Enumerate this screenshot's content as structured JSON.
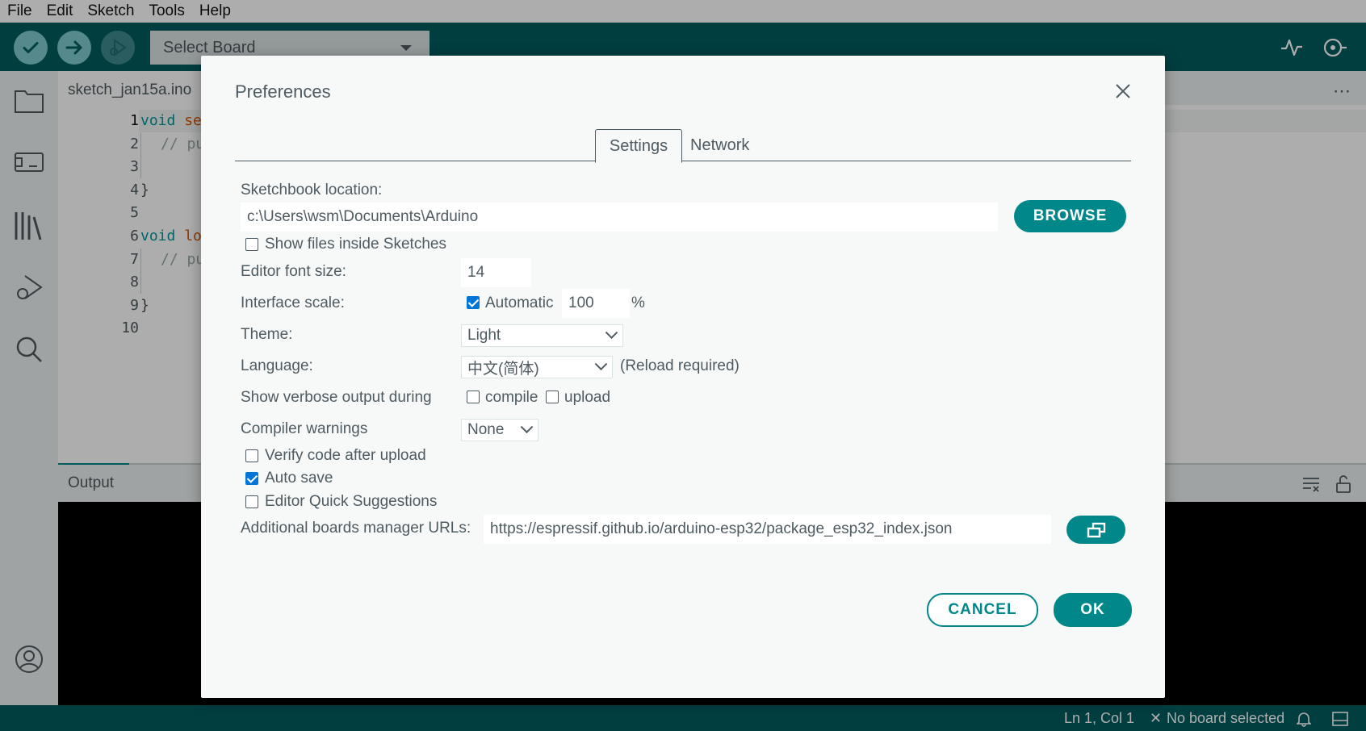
{
  "menu": [
    "File",
    "Edit",
    "Sketch",
    "Tools",
    "Help"
  ],
  "toolbar": {
    "board_select": "Select Board"
  },
  "editor": {
    "file_tab": "sketch_jan15a.ino",
    "line_numbers": [
      "1",
      "2",
      "3",
      "4",
      "5",
      "6",
      "7",
      "8",
      "9",
      "10"
    ],
    "code": {
      "l1_kw": "void",
      "l1_fn": "se",
      "l2": "// pu",
      "l4": "}",
      "l6_kw": "void",
      "l6_fn": "lo",
      "l7": "// pu",
      "l9": "}"
    }
  },
  "output": {
    "label": "Output"
  },
  "status": {
    "position": "Ln 1, Col 1",
    "board": "No board selected"
  },
  "dialog": {
    "title": "Preferences",
    "tabs": {
      "settings": "Settings",
      "network": "Network"
    },
    "sketchbook_label": "Sketchbook location:",
    "sketchbook_value": "c:\\Users\\wsm\\Documents\\Arduino",
    "browse_label": "BROWSE",
    "show_files_label": "Show files inside Sketches",
    "show_files_checked": false,
    "font_size_label": "Editor font size:",
    "font_size_value": "14",
    "scale_label": "Interface scale:",
    "scale_auto_label": "Automatic",
    "scale_auto_checked": true,
    "scale_value": "100",
    "scale_unit": "%",
    "theme_label": "Theme:",
    "theme_value": "Light",
    "language_label": "Language:",
    "language_value": "中文(简体)",
    "language_note": "(Reload required)",
    "verbose_label": "Show verbose output during",
    "verbose_compile_label": "compile",
    "verbose_compile_checked": false,
    "verbose_upload_label": "upload",
    "verbose_upload_checked": false,
    "warnings_label": "Compiler warnings",
    "warnings_value": "None",
    "verify_label": "Verify code after upload",
    "verify_checked": false,
    "autosave_label": "Auto save",
    "autosave_checked": true,
    "quick_suggest_label": "Editor Quick Suggestions",
    "quick_suggest_checked": false,
    "boards_url_label": "Additional boards manager URLs:",
    "boards_url_value": "https://espressif.github.io/arduino-esp32/package_esp32_index.json",
    "cancel_label": "CANCEL",
    "ok_label": "OK"
  },
  "colors": {
    "teal_dark": "#005c5f",
    "teal": "#00878a",
    "accent_light": "#7fcbcd",
    "check_blue": "#0075d8"
  }
}
